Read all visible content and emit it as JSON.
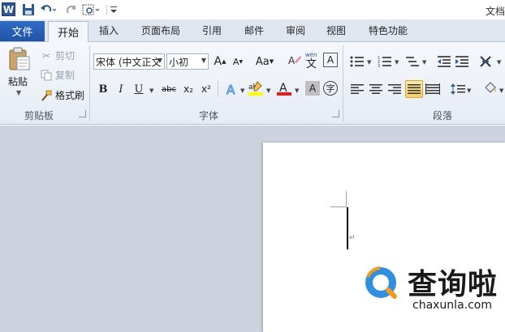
{
  "window": {
    "title": "文档"
  },
  "quick_access": {
    "app_logo": "W"
  },
  "tabs": {
    "file": "文件",
    "items": [
      "开始",
      "插入",
      "页面布局",
      "引用",
      "邮件",
      "审阅",
      "视图",
      "特色功能"
    ]
  },
  "clipboard": {
    "paste": "粘贴",
    "cut": "剪切",
    "copy": "复制",
    "format_painter": "格式刷",
    "group_label": "剪贴板"
  },
  "font": {
    "font_name": "宋体 (中文正文",
    "font_size": "小初",
    "group_label": "字体",
    "bold": "B",
    "italic": "I",
    "underline": "U",
    "strikethrough": "abc",
    "subscript": "x₂",
    "superscript": "x²",
    "change_case": "Aa",
    "wen": "wén",
    "clear": "A",
    "char_border": "A",
    "enclose": "字",
    "grow": "A",
    "shrink": "A",
    "font_color": "A",
    "shading": "A"
  },
  "paragraph": {
    "group_label": "段落"
  },
  "watermark": {
    "title": "查询啦",
    "url": "chaxunla.com"
  },
  "colors": {
    "accent": "#1f54a6",
    "ribbon": "#e6ecf5",
    "doc_bg": "#ccd3de",
    "highlight": "#f8cf62"
  }
}
